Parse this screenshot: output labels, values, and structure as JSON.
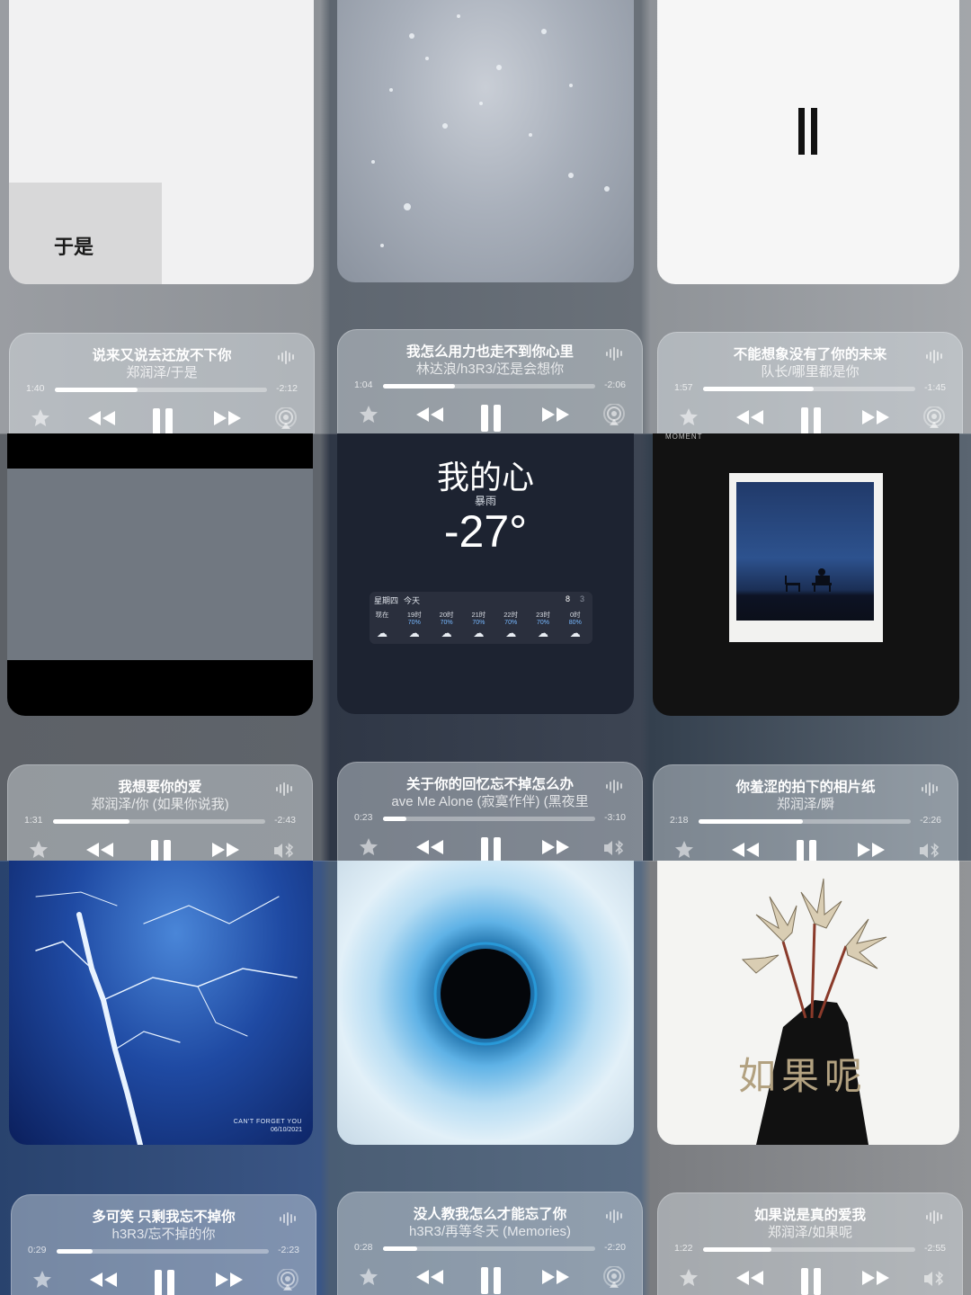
{
  "cards": [
    {
      "title": "说来又说去还放不下你",
      "subtitle": "郑润泽/于是",
      "elapsed": "1:40",
      "remaining": "-2:12",
      "progress": 0.39,
      "output_icon": "airplay-icon"
    },
    {
      "title": "我怎么用力也走不到你心里",
      "subtitle": "林达浪/h3R3/还是会想你",
      "elapsed": "1:04",
      "remaining": "-2:06",
      "progress": 0.34,
      "output_icon": "airplay-icon"
    },
    {
      "title": "不能想象没有了你的未来",
      "subtitle": "队长/哪里都是你",
      "elapsed": "1:57",
      "remaining": "-1:45",
      "progress": 0.52,
      "output_icon": "airplay-icon"
    },
    {
      "title": "我想要你的爱",
      "subtitle": "郑润泽/你 (如果你说我)",
      "elapsed": "1:31",
      "remaining": "-2:43",
      "progress": 0.36,
      "output_icon": "bluetooth-speaker-icon"
    },
    {
      "title": "关于你的回忆忘不掉怎么办",
      "subtitle": "ave Me Alone (寂寞作伴) (黑夜里",
      "elapsed": "0:23",
      "remaining": "-3:10",
      "progress": 0.11,
      "output_icon": "bluetooth-speaker-icon"
    },
    {
      "title": "你羞涩的拍下的相片纸",
      "subtitle": "郑润泽/瞬",
      "elapsed": "2:18",
      "remaining": "-2:26",
      "progress": 0.49,
      "output_icon": "bluetooth-speaker-icon"
    },
    {
      "title": "多可笑 只剩我忘不掉你",
      "subtitle": "h3R3/忘不掉的你",
      "elapsed": "0:29",
      "remaining": "-2:23",
      "progress": 0.17,
      "output_icon": "airplay-icon"
    },
    {
      "title": "没人教我怎么才能忘了你",
      "subtitle": "h3R3/再等冬天 (Memories)",
      "elapsed": "0:28",
      "remaining": "-2:20",
      "progress": 0.16,
      "output_icon": "airplay-icon"
    },
    {
      "title": "如果说是真的爱我",
      "subtitle": "郑润泽/如果呢",
      "elapsed": "1:22",
      "remaining": "-2:55",
      "progress": 0.32,
      "output_icon": "bluetooth-speaker-icon"
    }
  ],
  "art": {
    "yushi_text": "于是",
    "moment_text": "MOMENT",
    "lightning_caption_1": "CAN'T FORGET YOU",
    "lightning_caption_2": "06/10/2021",
    "ruguo_text": "如果呢"
  },
  "weather": {
    "location": "我的心",
    "condition": "暴雨",
    "temp": "-27°",
    "day": "星期四",
    "today": "今天",
    "high": "8",
    "low": "3",
    "hours": [
      {
        "h": "现在",
        "p": ""
      },
      {
        "h": "19时",
        "p": "70%"
      },
      {
        "h": "20时",
        "p": "70%"
      },
      {
        "h": "21时",
        "p": "70%"
      },
      {
        "h": "22时",
        "p": "70%"
      },
      {
        "h": "23时",
        "p": "70%"
      },
      {
        "h": "0时",
        "p": "80%"
      }
    ]
  },
  "colors": {
    "accent": "#ffffff",
    "track": "#cfd4da",
    "rain_prob": "#77b8ff"
  }
}
